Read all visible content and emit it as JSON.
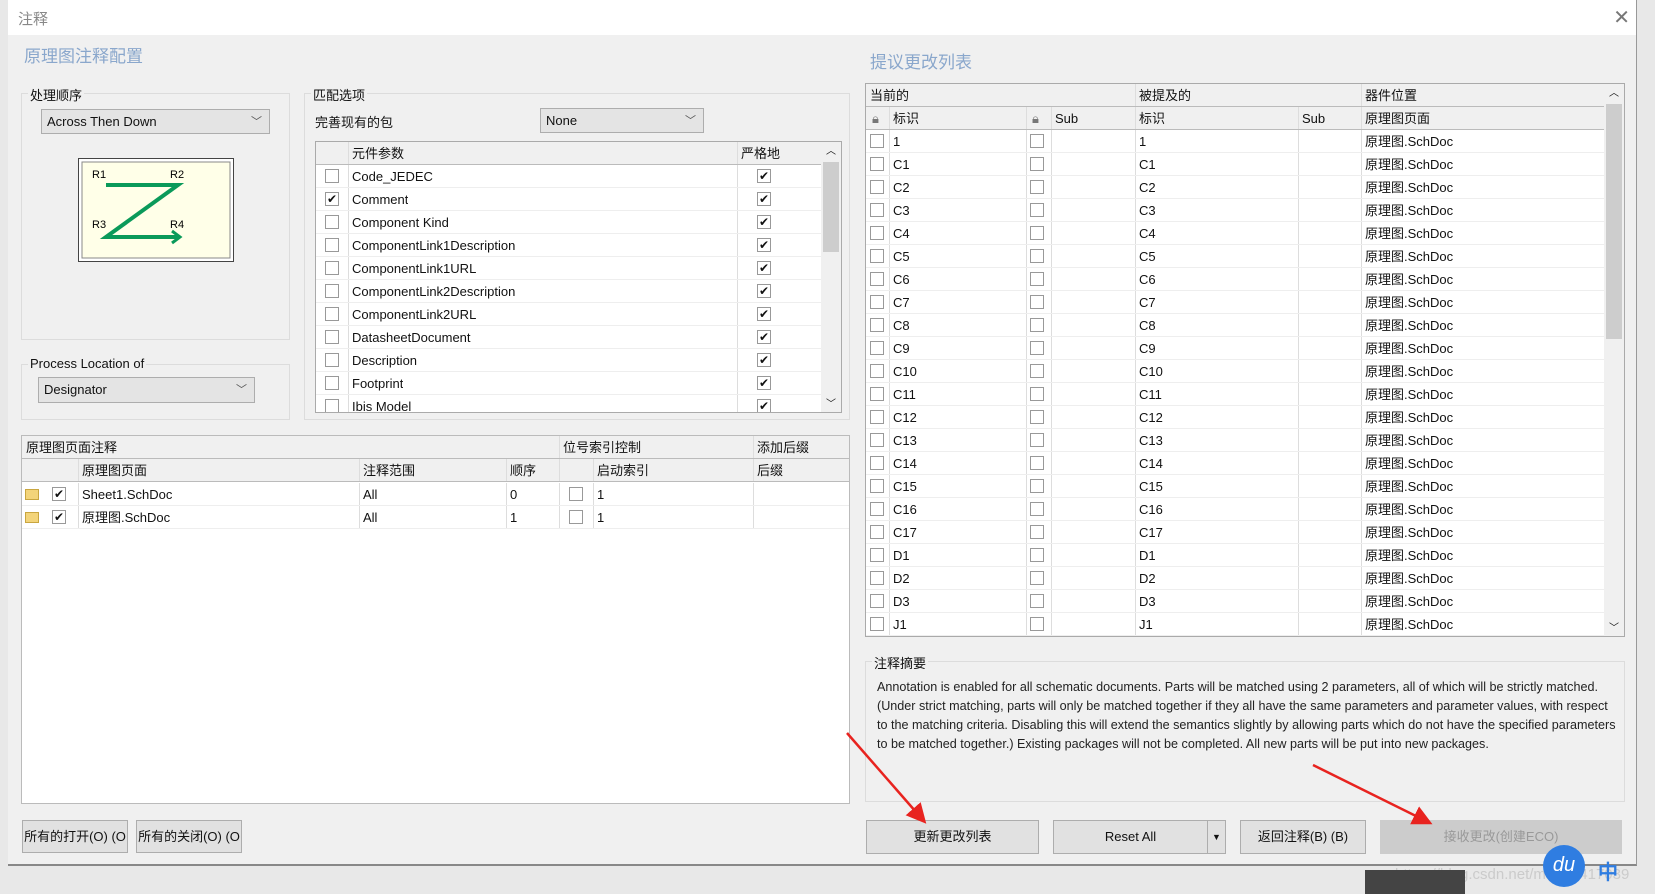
{
  "window": {
    "title": "注释",
    "close_icon": "close-icon"
  },
  "left": {
    "heading": "原理图注释配置",
    "order_group": {
      "label": "处理顺序",
      "value": "Across Then Down",
      "preview_labels": [
        "R1",
        "R2",
        "R3",
        "R4"
      ]
    },
    "location_group": {
      "label": "Process Location of",
      "value": "Designator"
    },
    "match": {
      "label": "匹配选项",
      "complete_label": "完善现有的包",
      "complete_value": "None",
      "columns": [
        "元件参数",
        "严格地"
      ],
      "rows": [
        {
          "name": "Code_JEDEC",
          "checked": false,
          "strict": true
        },
        {
          "name": "Comment",
          "checked": true,
          "strict": true
        },
        {
          "name": "Component Kind",
          "checked": false,
          "strict": true
        },
        {
          "name": "ComponentLink1Description",
          "checked": false,
          "strict": true
        },
        {
          "name": "ComponentLink1URL",
          "checked": false,
          "strict": true
        },
        {
          "name": "ComponentLink2Description",
          "checked": false,
          "strict": true
        },
        {
          "name": "ComponentLink2URL",
          "checked": false,
          "strict": true
        },
        {
          "name": "DatasheetDocument",
          "checked": false,
          "strict": true
        },
        {
          "name": "Description",
          "checked": false,
          "strict": true
        },
        {
          "name": "Footprint",
          "checked": false,
          "strict": true
        },
        {
          "name": "Ibis Model",
          "checked": false,
          "strict": true
        }
      ]
    },
    "sheets": {
      "group_headers": [
        "原理图页面注释",
        "位号索引控制",
        "添加后缀"
      ],
      "columns": [
        "原理图页面",
        "注释范围",
        "顺序",
        "启动索引",
        "后缀"
      ],
      "rows": [
        {
          "checked": true,
          "page": "Sheet1.SchDoc",
          "scope": "All",
          "order": "0",
          "idx_checked": false,
          "start": "1",
          "suffix": ""
        },
        {
          "checked": true,
          "page": "原理图.SchDoc",
          "scope": "All",
          "order": "1",
          "idx_checked": false,
          "start": "1",
          "suffix": ""
        }
      ]
    },
    "buttons": {
      "open_all": "所有的打开(O) (O",
      "close_all": "所有的关闭(O) (O"
    }
  },
  "right": {
    "heading": "提议更改列表",
    "group_headers": [
      "当前的",
      "被提及的",
      "器件位置"
    ],
    "columns": [
      "标识",
      "Sub",
      "标识",
      "Sub",
      "原理图页面"
    ],
    "rows": [
      {
        "cur": "1",
        "prop": "1",
        "loc": "原理图.SchDoc"
      },
      {
        "cur": "C1",
        "prop": "C1",
        "loc": "原理图.SchDoc"
      },
      {
        "cur": "C2",
        "prop": "C2",
        "loc": "原理图.SchDoc"
      },
      {
        "cur": "C3",
        "prop": "C3",
        "loc": "原理图.SchDoc"
      },
      {
        "cur": "C4",
        "prop": "C4",
        "loc": "原理图.SchDoc"
      },
      {
        "cur": "C5",
        "prop": "C5",
        "loc": "原理图.SchDoc"
      },
      {
        "cur": "C6",
        "prop": "C6",
        "loc": "原理图.SchDoc"
      },
      {
        "cur": "C7",
        "prop": "C7",
        "loc": "原理图.SchDoc"
      },
      {
        "cur": "C8",
        "prop": "C8",
        "loc": "原理图.SchDoc"
      },
      {
        "cur": "C9",
        "prop": "C9",
        "loc": "原理图.SchDoc"
      },
      {
        "cur": "C10",
        "prop": "C10",
        "loc": "原理图.SchDoc"
      },
      {
        "cur": "C11",
        "prop": "C11",
        "loc": "原理图.SchDoc"
      },
      {
        "cur": "C12",
        "prop": "C12",
        "loc": "原理图.SchDoc"
      },
      {
        "cur": "C13",
        "prop": "C13",
        "loc": "原理图.SchDoc"
      },
      {
        "cur": "C14",
        "prop": "C14",
        "loc": "原理图.SchDoc"
      },
      {
        "cur": "C15",
        "prop": "C15",
        "loc": "原理图.SchDoc"
      },
      {
        "cur": "C16",
        "prop": "C16",
        "loc": "原理图.SchDoc"
      },
      {
        "cur": "C17",
        "prop": "C17",
        "loc": "原理图.SchDoc"
      },
      {
        "cur": "D1",
        "prop": "D1",
        "loc": "原理图.SchDoc"
      },
      {
        "cur": "D2",
        "prop": "D2",
        "loc": "原理图.SchDoc"
      },
      {
        "cur": "D3",
        "prop": "D3",
        "loc": "原理图.SchDoc"
      },
      {
        "cur": "J1",
        "prop": "J1",
        "loc": "原理图.SchDoc"
      }
    ],
    "summary": {
      "label": "注释摘要",
      "text": "Annotation is enabled for all schematic documents. Parts will be matched using 2 parameters, all of which will be strictly matched. (Under strict matching, parts will only be matched together if they all have the same parameters and parameter values, with respect to the matching criteria. Disabling this will extend the semantics slightly by allowing parts which do not have the specified parameters to be matched together.) Existing packages will not be completed. All new parts will be put into new packages."
    },
    "buttons": {
      "update": "更新更改列表",
      "reset": "Reset All",
      "back": "返回注释(B) (B)",
      "accept": "接收更改(创建ECO)"
    }
  },
  "watermark": "https://blog.csdn.net/m0_49417039",
  "colors": {
    "heading": "#8aa7cc",
    "arrow": "#e8231f",
    "check_green": "#0a9a5a"
  }
}
